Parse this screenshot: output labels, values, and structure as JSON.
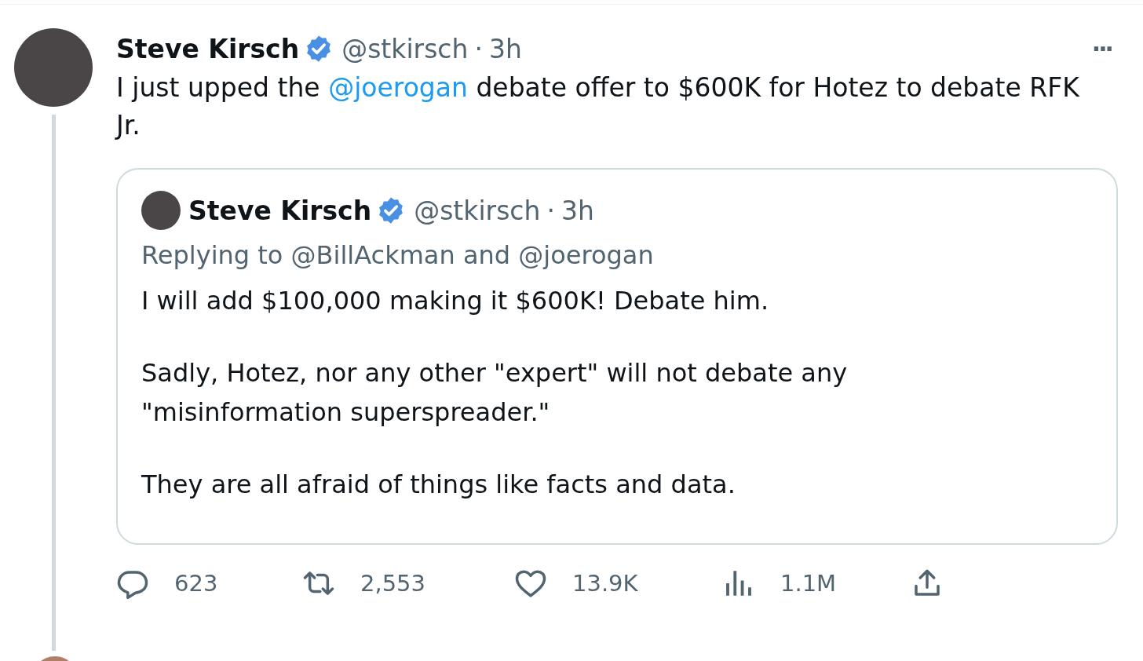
{
  "tweet": {
    "author": {
      "name": "Steve Kirsch",
      "verified": true,
      "handle": "@stkirsch",
      "separator": "·",
      "time": "3h"
    },
    "more": "···",
    "text": [
      {
        "kind": "text",
        "text": "I just upped the "
      },
      {
        "kind": "mention",
        "text": "@joerogan"
      },
      {
        "kind": "text",
        "text": " debate offer to $600K for Hotez to debate RFK Jr."
      }
    ],
    "quote": {
      "author": {
        "name": "Steve Kirsch",
        "verified": true,
        "handle": "@stkirsch",
        "separator": "·",
        "time": "3h"
      },
      "replying_to": "Replying to @BillAckman and @joerogan",
      "paragraphs": [
        "I will add $100,000 making it $600K! Debate him.",
        "Sadly, Hotez, nor any other \"expert\" will not debate any \"misinformation superspreader.\"",
        "They are all afraid of things like facts and data."
      ]
    },
    "actions": [
      {
        "kind": "reply",
        "count": "623"
      },
      {
        "kind": "repost",
        "count": "2,553"
      },
      {
        "kind": "like",
        "count": "13.9K"
      },
      {
        "kind": "views",
        "count": "1.1M"
      },
      {
        "kind": "share"
      }
    ]
  }
}
